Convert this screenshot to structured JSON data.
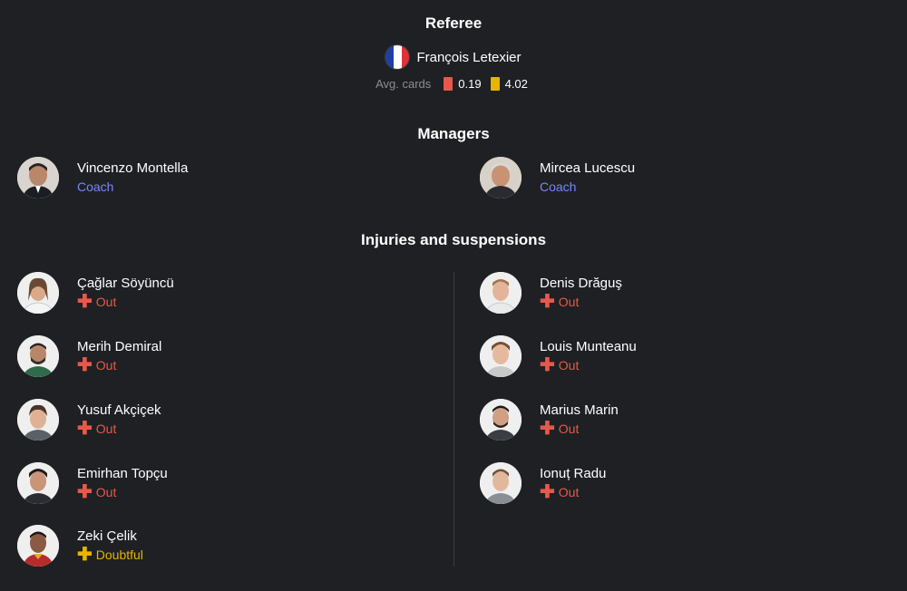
{
  "referee": {
    "title": "Referee",
    "name": "François Letexier",
    "flag_colors": [
      "#1f3fa8",
      "#ffffff",
      "#e0303a"
    ],
    "avg_label": "Avg. cards",
    "red_value": "0.19",
    "yellow_value": "4.02",
    "red_color": "#e8584a",
    "yellow_color": "#e7b400"
  },
  "managers": {
    "title": "Managers",
    "home": {
      "name": "Vincenzo Montella",
      "role": "Coach"
    },
    "away": {
      "name": "Mircea Lucescu",
      "role": "Coach"
    }
  },
  "injuries": {
    "title": "Injuries and suspensions",
    "status_colors": {
      "out": "#e8584a",
      "doubtful": "#e7b400"
    },
    "home": [
      {
        "name": "Çağlar Söyüncü",
        "status": "Out"
      },
      {
        "name": "Merih Demiral",
        "status": "Out"
      },
      {
        "name": "Yusuf Akçiçek",
        "status": "Out"
      },
      {
        "name": "Emirhan Topçu",
        "status": "Out"
      },
      {
        "name": "Zeki Çelik",
        "status": "Doubtful"
      }
    ],
    "away": [
      {
        "name": "Denis Drăguş",
        "status": "Out"
      },
      {
        "name": "Louis Munteanu",
        "status": "Out"
      },
      {
        "name": "Marius Marin",
        "status": "Out"
      },
      {
        "name": "Ionuț Radu",
        "status": "Out"
      }
    ]
  }
}
